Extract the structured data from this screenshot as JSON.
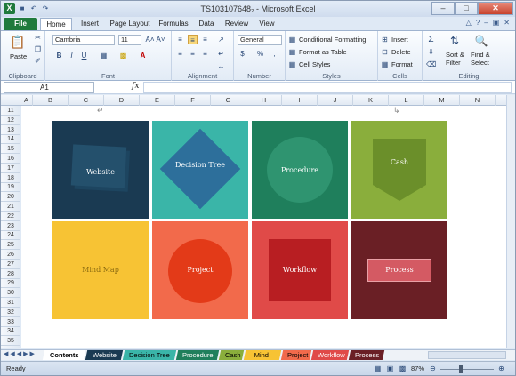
{
  "window": {
    "title": "TS103107648₂ - Microsoft Excel"
  },
  "qat": {
    "app_icon": "excel-icon",
    "save_icon": "save-icon",
    "undo_icon": "undo-icon",
    "redo_icon": "redo-icon"
  },
  "tabs": [
    "File",
    "Home",
    "Insert",
    "Page Layout",
    "Formulas",
    "Data",
    "Review",
    "View"
  ],
  "ribbon": {
    "clipboard": {
      "label": "Clipboard",
      "paste": "Paste"
    },
    "font": {
      "label": "Font",
      "name": "Cambria",
      "size": "11",
      "bold": "B",
      "italic": "I",
      "underline": "U",
      "grow": "A˄",
      "shrink": "A˅"
    },
    "alignment": {
      "label": "Alignment"
    },
    "number": {
      "label": "Number",
      "format": "General",
      "currency": "$",
      "percent": "%",
      "comma": ","
    },
    "styles": {
      "label": "Styles",
      "conditional": "Conditional Formatting",
      "format_table": "Format as Table",
      "cell_styles": "Cell Styles"
    },
    "cells": {
      "label": "Cells",
      "insert": "Insert",
      "delete": "Delete",
      "format": "Format"
    },
    "editing": {
      "label": "Editing",
      "sum": "Σ",
      "sort": "Sort &",
      "filter": "Filter",
      "find": "Find &",
      "select": "Select"
    }
  },
  "formula_bar": {
    "name_box": "A1",
    "fx": "fx",
    "value": ""
  },
  "columns": [
    "A",
    "B",
    "C",
    "D",
    "E",
    "F",
    "G",
    "H",
    "I",
    "J",
    "K",
    "L",
    "M",
    "N"
  ],
  "rows": [
    "11",
    "12",
    "13",
    "14",
    "15",
    "16",
    "17",
    "18",
    "19",
    "20",
    "21",
    "22",
    "23",
    "24",
    "25",
    "26",
    "27",
    "28",
    "29",
    "30",
    "31",
    "32",
    "33",
    "34",
    "35"
  ],
  "tiles": [
    {
      "label": "Website",
      "bg": "#1a3a52",
      "accent": "#24506c"
    },
    {
      "label": "Decision Tree",
      "bg": "#3ab5a8",
      "accent": "#2d6f9b"
    },
    {
      "label": "Procedure",
      "bg": "#1f7f5c",
      "accent": "#2f9470"
    },
    {
      "label": "Cash",
      "bg": "#8aae3c",
      "accent": "#6b8f2a"
    },
    {
      "label": "Mind Map",
      "bg": "#f7c334",
      "accent": "#f7c334"
    },
    {
      "label": "Project",
      "bg": "#f26a4b",
      "accent": "#e33a18"
    },
    {
      "label": "Workflow",
      "bg": "#e04a48",
      "accent": "#b81e22"
    },
    {
      "label": "Process",
      "bg": "#6a1f25",
      "accent": "#d45a63"
    }
  ],
  "sheet_tabs": [
    {
      "label": "Contents",
      "bg": "#ffffff",
      "color": "#000000"
    },
    {
      "label": "Website",
      "bg": "#1a3a52",
      "color": "#ffffff"
    },
    {
      "label": "Decision Tree",
      "bg": "#3ab5a8",
      "color": "#000000"
    },
    {
      "label": "Procedure",
      "bg": "#1f7f5c",
      "color": "#ffffff"
    },
    {
      "label": "Cash",
      "bg": "#8aae3c",
      "color": "#000000"
    },
    {
      "label": "Mind Map",
      "bg": "#f7c334",
      "color": "#000000"
    },
    {
      "label": "Project",
      "bg": "#f26a4b",
      "color": "#000000"
    },
    {
      "label": "Workflow",
      "bg": "#e04a48",
      "color": "#ffffff"
    },
    {
      "label": "Process",
      "bg": "#6a1f25",
      "color": "#ffffff"
    }
  ],
  "status": {
    "ready": "Ready",
    "zoom": "87%"
  }
}
